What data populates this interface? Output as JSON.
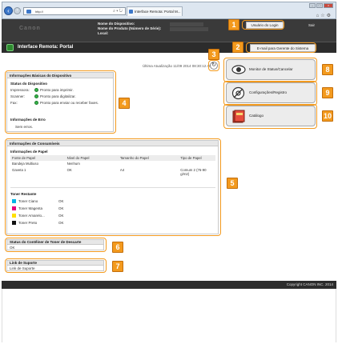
{
  "browser": {
    "address": "http://",
    "tab_label": "Interface Remota: Portal M..."
  },
  "header": {
    "logo": "Canon",
    "device_name_label": "Nome do Dispositivo:",
    "product_label": "Nome do Produto (Número de Série):",
    "location_label": "Local:",
    "login_button": "Usuário do Login",
    "logout_link": "Sair"
  },
  "titlebar": {
    "title": "Interface Remota: Portal",
    "email_button": "E-mail para Gerente do Sistema"
  },
  "status": {
    "last_update": "Última Atualização 11/09 2014 08:30:12 AM"
  },
  "basic_info": {
    "heading": "Informações Básicas do Dispositivo",
    "device_status_heading": "Status do Dispositivo",
    "rows": [
      {
        "label": "Impressora:",
        "value": "Pronto para imprimir."
      },
      {
        "label": "Scanner:",
        "value": "Pronto para digitalizar."
      },
      {
        "label": "Fax:",
        "value": "Pronto para enviar ou receber faxes."
      }
    ],
    "error_heading": "Informações de Erro",
    "error_value": "Sem erros."
  },
  "consumables": {
    "heading": "Informações de Consumíveis",
    "paper_heading": "Informações de Papel",
    "columns": [
      "Fonte de Papel",
      "Nível do Papel",
      "Tamanho do Papel",
      "Tipo de Papel"
    ],
    "rows": [
      [
        "Bandeja Multiuso",
        "Nenhum",
        "",
        ""
      ],
      [
        "Gaveta 1",
        "OK",
        "A4",
        "Comum 2 (76-90 g/m2)"
      ]
    ],
    "toner_heading": "Toner Restante",
    "toners": [
      {
        "name": "Toner Ciano",
        "status": "OK",
        "color": "#00b4e6"
      },
      {
        "name": "Toner Magenta",
        "status": "OK",
        "color": "#e6007e"
      },
      {
        "name": "Toner Amarelo...",
        "status": "OK",
        "color": "#ffe000"
      },
      {
        "name": "Toner Preto",
        "status": "OK",
        "color": "#111111"
      }
    ]
  },
  "waste_toner": {
    "heading": "Status do Contêiner de Toner de Descarte",
    "value": "OK"
  },
  "support": {
    "heading": "Link de Suporte",
    "value": "Link de Suporte"
  },
  "side_menu": {
    "status_monitor": "Monitor de Status/Cancelar",
    "settings": "Configurações/Registro",
    "catalog": "Catálogo"
  },
  "callouts": [
    "1",
    "2",
    "3",
    "4",
    "5",
    "6",
    "7",
    "8",
    "9",
    "10"
  ],
  "footer": {
    "copyright": "Copyright CANON INC. 2014"
  },
  "colors": {
    "accent": "#f39a1e",
    "header_bg": "#3a3a3a",
    "ok_green": "#37b44a"
  }
}
